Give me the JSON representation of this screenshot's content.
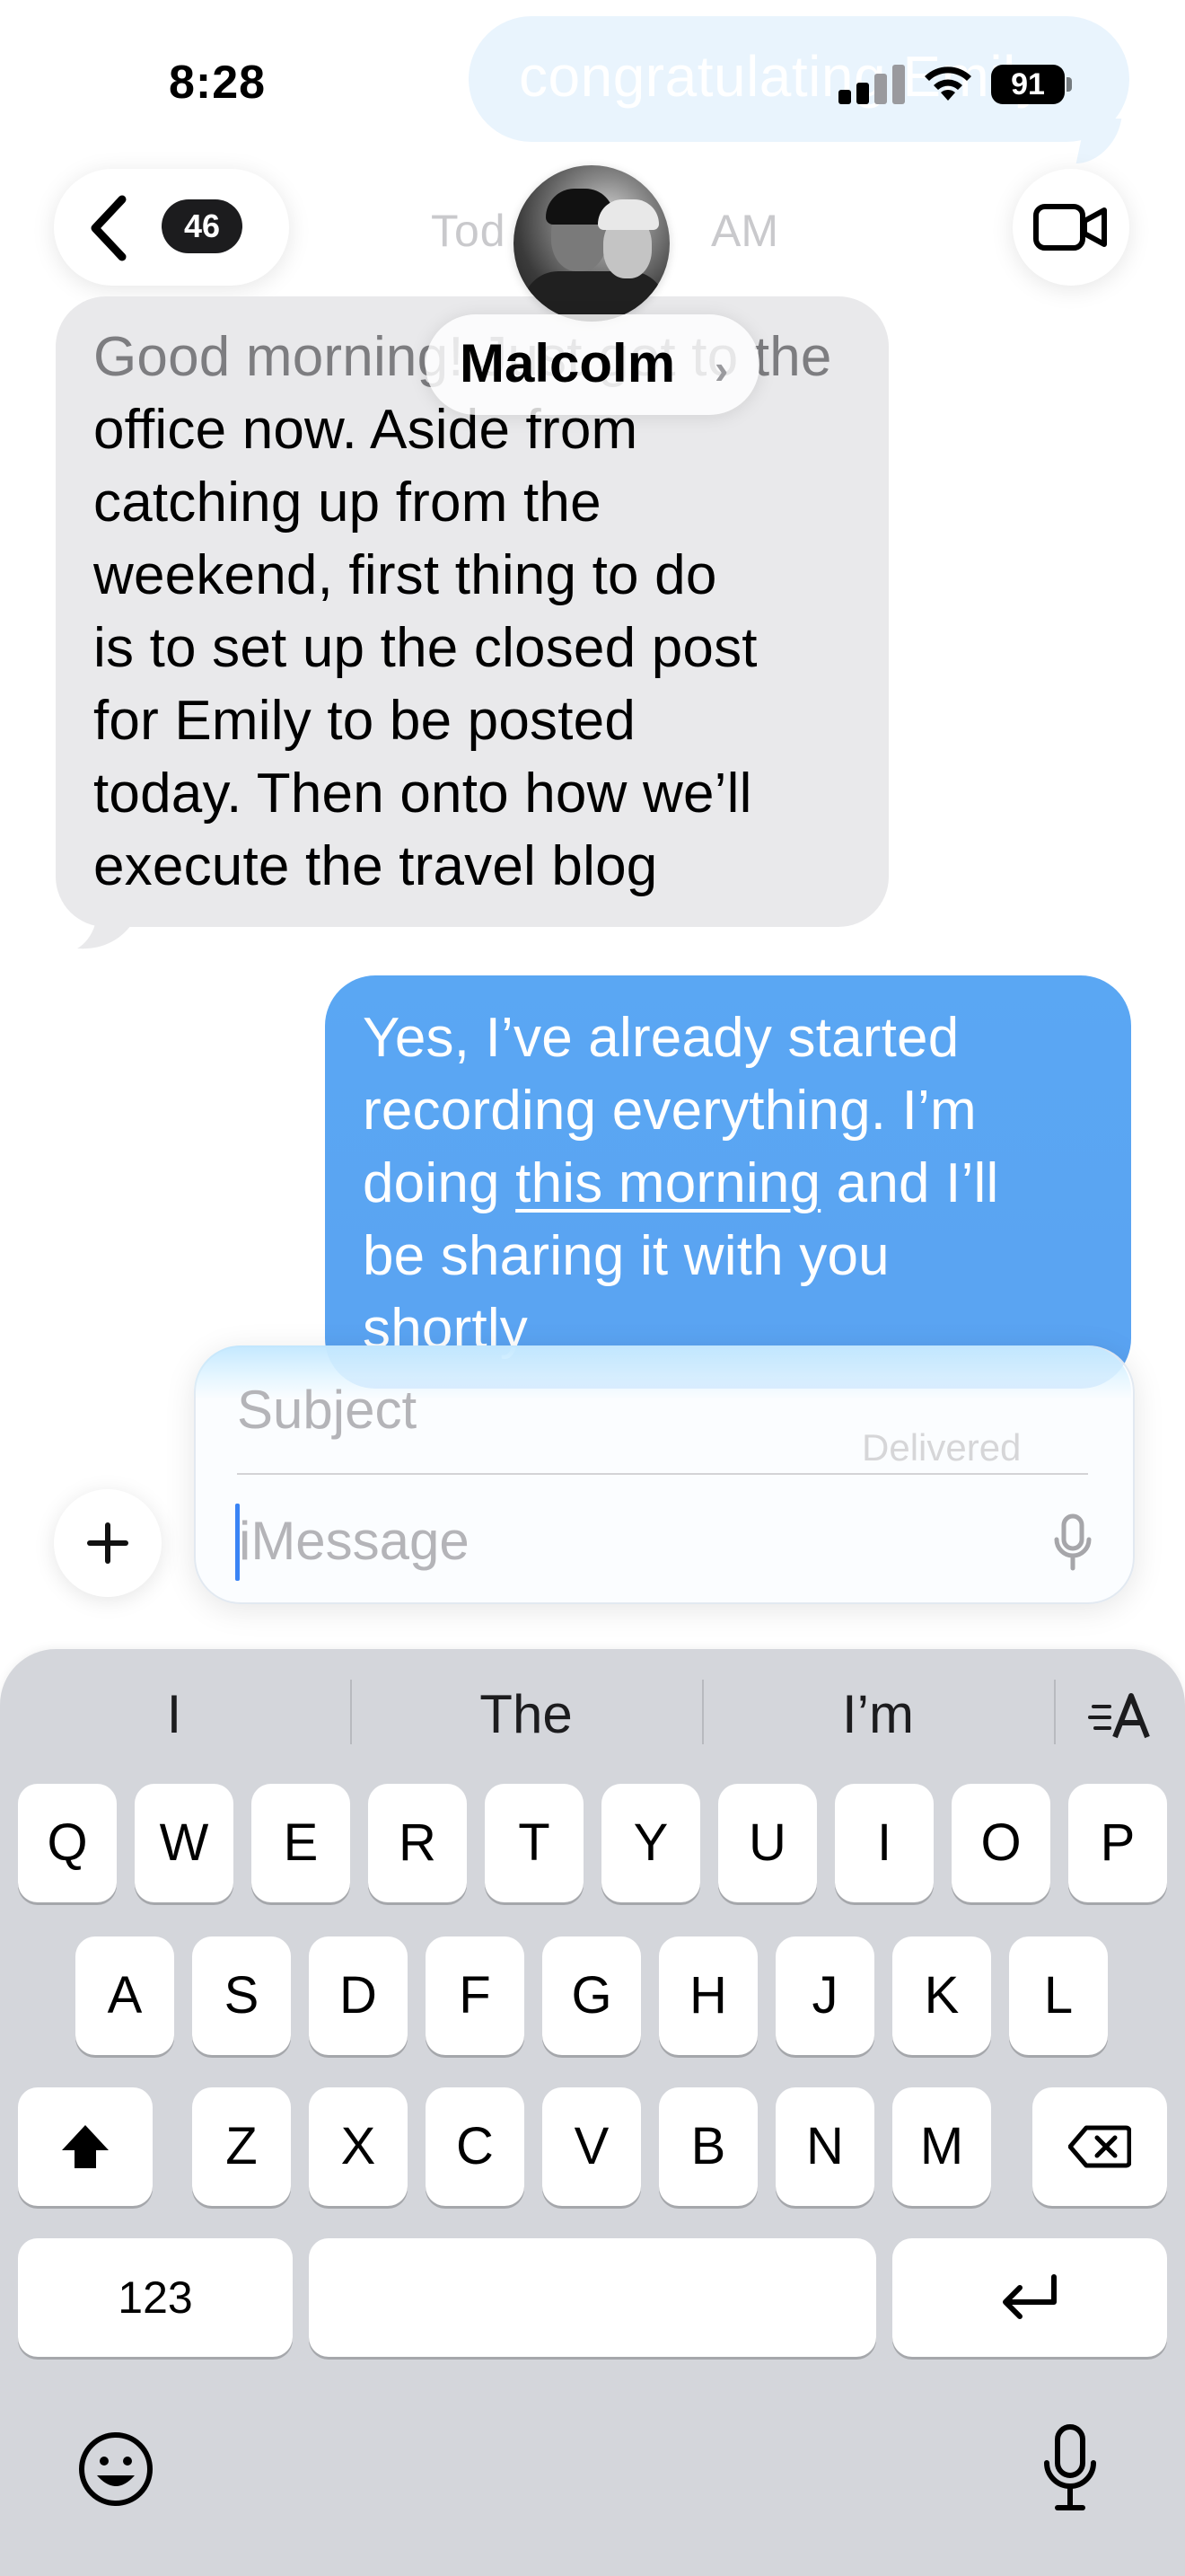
{
  "status_bar": {
    "time": "8:28",
    "battery": "91"
  },
  "thread": {
    "top_bubble_text": "congratulating Emily",
    "date_label": "Tod",
    "date_label_tail": "AM",
    "unread_count": "46",
    "contact_name": "Malcolm",
    "incoming_lines": [
      "Good morning! Just got to the",
      "office now. Aside from",
      "catching up from the",
      "weekend, first thing to do",
      "is to set up the closed post",
      "for Emily to be posted",
      "today. Then onto how we’ll",
      "execute the travel blog"
    ],
    "outgoing": {
      "line1": "Yes, I’ve already started",
      "line2": "recording everything. I’m",
      "line3_pre": "doing ",
      "line3_link": "this morning",
      "line3_post": " and I’ll",
      "line4": "be sharing it with you",
      "line5": "shortly"
    },
    "delivered": "Delivered"
  },
  "compose": {
    "subject_placeholder": "Subject",
    "message_placeholder": "iMessage"
  },
  "keyboard": {
    "predictions": [
      "I",
      "The",
      "I’m"
    ],
    "row1": [
      "Q",
      "W",
      "E",
      "R",
      "T",
      "Y",
      "U",
      "I",
      "O",
      "P"
    ],
    "row2": [
      "A",
      "S",
      "D",
      "F",
      "G",
      "H",
      "J",
      "K",
      "L"
    ],
    "row3": [
      "Z",
      "X",
      "C",
      "V",
      "B",
      "N",
      "M"
    ],
    "numbers_key": "123"
  },
  "icons": {
    "back": "chevron-left-icon",
    "video": "video-camera-icon",
    "plus": "plus-icon",
    "mic": "microphone-icon",
    "emoji": "smiley-face-icon",
    "shift": "shift-arrow-icon",
    "delete": "backspace-icon",
    "return": "return-arrow-icon",
    "text_format": "text-format-icon"
  },
  "colors": {
    "outgoing_bubble": "#5aa7f3",
    "incoming_bubble": "#e9e9eb",
    "keyboard_bg": "#d4d6db",
    "caret": "#3a84f5"
  }
}
